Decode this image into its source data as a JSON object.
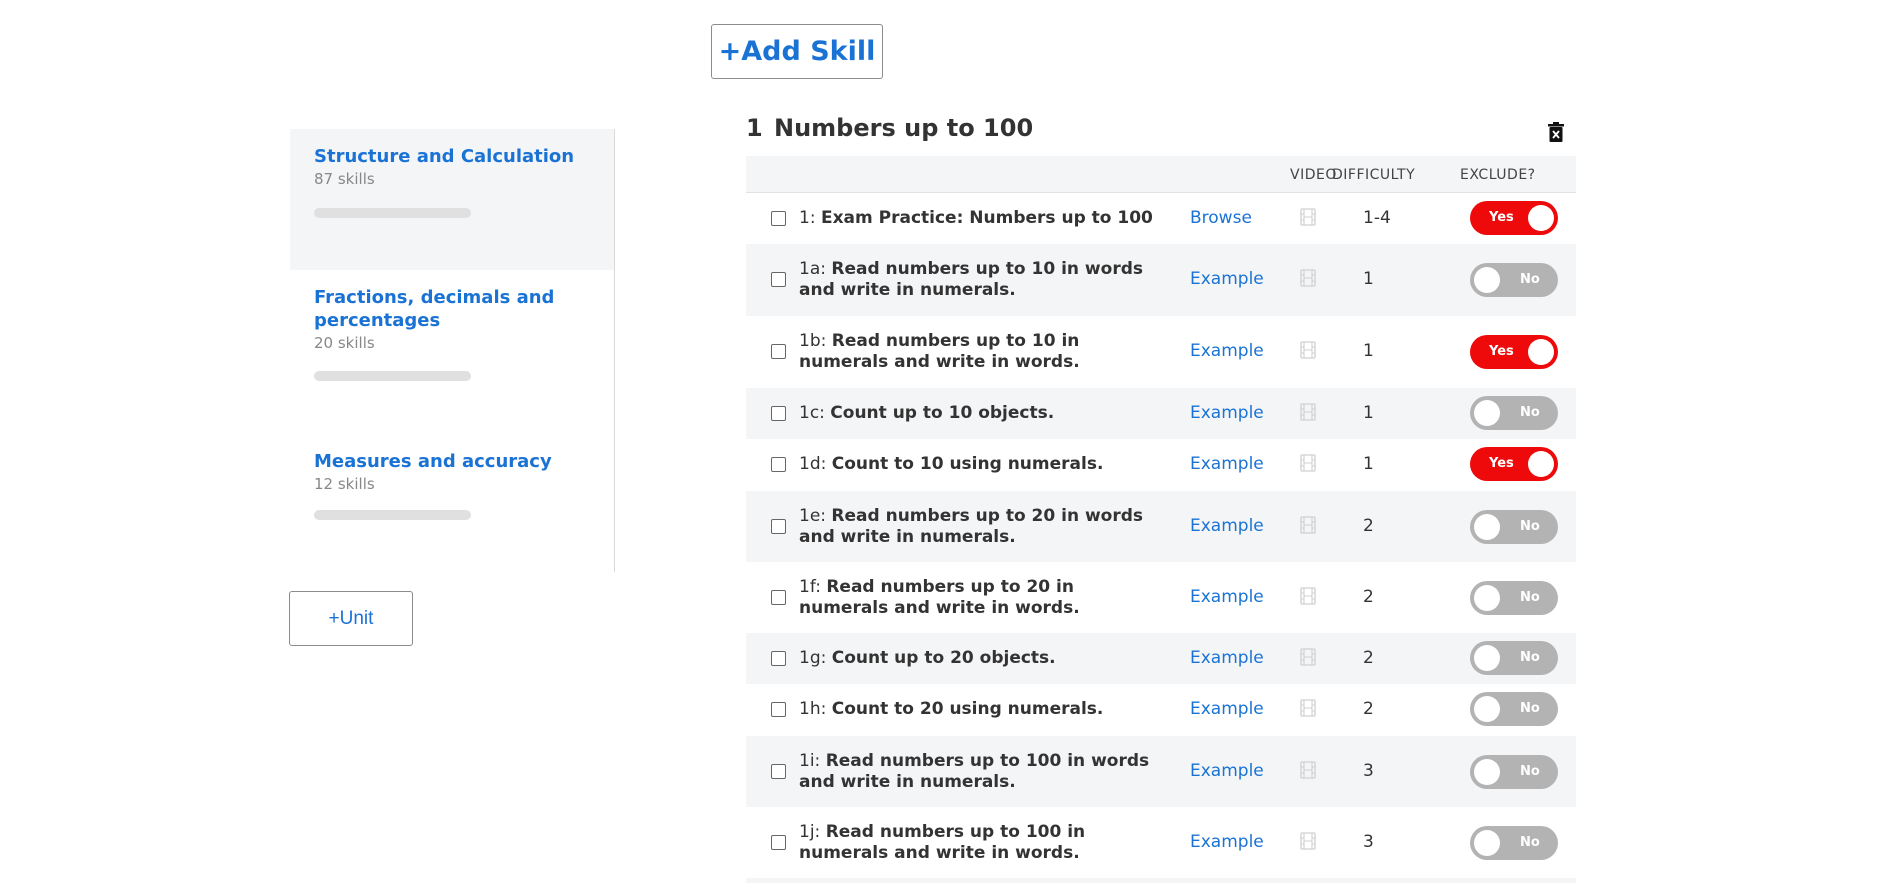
{
  "toolbar": {
    "add_skill_label": "+Add Skill"
  },
  "sidebar": {
    "units": [
      {
        "title": "Structure and Calculation",
        "count": "87 skills",
        "progress": 0
      },
      {
        "title": "Fractions, decimals and percentages",
        "count": "20 skills",
        "progress": 0
      },
      {
        "title": "Measures and accuracy",
        "count": "12 skills",
        "progress": 0
      }
    ],
    "add_unit_label": "+Unit"
  },
  "section": {
    "number": "1",
    "title": "Numbers up to 100",
    "columns": {
      "video": "VIDEO",
      "difficulty": "DIFFICULTY",
      "exclude": "EXCLUDE?"
    },
    "rows": [
      {
        "code": "1:",
        "name": "Exam Practice: Numbers up to 100",
        "link": "Browse",
        "difficulty": "1-4",
        "exclude": "Yes"
      },
      {
        "code": "1a:",
        "name": "Read numbers up to 10 in words and write in numerals.",
        "link": "Example",
        "difficulty": "1",
        "exclude": "No"
      },
      {
        "code": "1b:",
        "name": "Read numbers up to 10 in numerals and write in words.",
        "link": "Example",
        "difficulty": "1",
        "exclude": "Yes"
      },
      {
        "code": "1c:",
        "name": "Count up to 10 objects.",
        "link": "Example",
        "difficulty": "1",
        "exclude": "No"
      },
      {
        "code": "1d:",
        "name": "Count to 10 using numerals.",
        "link": "Example",
        "difficulty": "1",
        "exclude": "Yes"
      },
      {
        "code": "1e:",
        "name": "Read numbers up to 20 in words and write in numerals.",
        "link": "Example",
        "difficulty": "2",
        "exclude": "No"
      },
      {
        "code": "1f:",
        "name": "Read numbers up to 20 in numerals and write in words.",
        "link": "Example",
        "difficulty": "2",
        "exclude": "No"
      },
      {
        "code": "1g:",
        "name": "Count up to 20 objects.",
        "link": "Example",
        "difficulty": "2",
        "exclude": "No"
      },
      {
        "code": "1h:",
        "name": "Count to 20 using numerals.",
        "link": "Example",
        "difficulty": "2",
        "exclude": "No"
      },
      {
        "code": "1i:",
        "name": "Read numbers up to 100 in words and write in numerals.",
        "link": "Example",
        "difficulty": "3",
        "exclude": "No"
      },
      {
        "code": "1j:",
        "name": "Read numbers up to 100 in numerals and write in words.",
        "link": "Example",
        "difficulty": "3",
        "exclude": "No"
      }
    ]
  }
}
